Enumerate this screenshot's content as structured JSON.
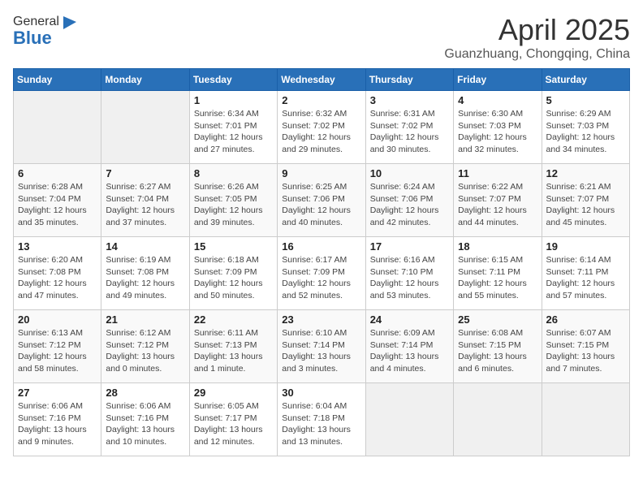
{
  "logo": {
    "general": "General",
    "blue": "Blue"
  },
  "title": "April 2025",
  "location": "Guanzhuang, Chongqing, China",
  "weekdays": [
    "Sunday",
    "Monday",
    "Tuesday",
    "Wednesday",
    "Thursday",
    "Friday",
    "Saturday"
  ],
  "weeks": [
    [
      {
        "day": null
      },
      {
        "day": null
      },
      {
        "day": "1",
        "sunrise": "Sunrise: 6:34 AM",
        "sunset": "Sunset: 7:01 PM",
        "daylight": "Daylight: 12 hours and 27 minutes."
      },
      {
        "day": "2",
        "sunrise": "Sunrise: 6:32 AM",
        "sunset": "Sunset: 7:02 PM",
        "daylight": "Daylight: 12 hours and 29 minutes."
      },
      {
        "day": "3",
        "sunrise": "Sunrise: 6:31 AM",
        "sunset": "Sunset: 7:02 PM",
        "daylight": "Daylight: 12 hours and 30 minutes."
      },
      {
        "day": "4",
        "sunrise": "Sunrise: 6:30 AM",
        "sunset": "Sunset: 7:03 PM",
        "daylight": "Daylight: 12 hours and 32 minutes."
      },
      {
        "day": "5",
        "sunrise": "Sunrise: 6:29 AM",
        "sunset": "Sunset: 7:03 PM",
        "daylight": "Daylight: 12 hours and 34 minutes."
      }
    ],
    [
      {
        "day": "6",
        "sunrise": "Sunrise: 6:28 AM",
        "sunset": "Sunset: 7:04 PM",
        "daylight": "Daylight: 12 hours and 35 minutes."
      },
      {
        "day": "7",
        "sunrise": "Sunrise: 6:27 AM",
        "sunset": "Sunset: 7:04 PM",
        "daylight": "Daylight: 12 hours and 37 minutes."
      },
      {
        "day": "8",
        "sunrise": "Sunrise: 6:26 AM",
        "sunset": "Sunset: 7:05 PM",
        "daylight": "Daylight: 12 hours and 39 minutes."
      },
      {
        "day": "9",
        "sunrise": "Sunrise: 6:25 AM",
        "sunset": "Sunset: 7:06 PM",
        "daylight": "Daylight: 12 hours and 40 minutes."
      },
      {
        "day": "10",
        "sunrise": "Sunrise: 6:24 AM",
        "sunset": "Sunset: 7:06 PM",
        "daylight": "Daylight: 12 hours and 42 minutes."
      },
      {
        "day": "11",
        "sunrise": "Sunrise: 6:22 AM",
        "sunset": "Sunset: 7:07 PM",
        "daylight": "Daylight: 12 hours and 44 minutes."
      },
      {
        "day": "12",
        "sunrise": "Sunrise: 6:21 AM",
        "sunset": "Sunset: 7:07 PM",
        "daylight": "Daylight: 12 hours and 45 minutes."
      }
    ],
    [
      {
        "day": "13",
        "sunrise": "Sunrise: 6:20 AM",
        "sunset": "Sunset: 7:08 PM",
        "daylight": "Daylight: 12 hours and 47 minutes."
      },
      {
        "day": "14",
        "sunrise": "Sunrise: 6:19 AM",
        "sunset": "Sunset: 7:08 PM",
        "daylight": "Daylight: 12 hours and 49 minutes."
      },
      {
        "day": "15",
        "sunrise": "Sunrise: 6:18 AM",
        "sunset": "Sunset: 7:09 PM",
        "daylight": "Daylight: 12 hours and 50 minutes."
      },
      {
        "day": "16",
        "sunrise": "Sunrise: 6:17 AM",
        "sunset": "Sunset: 7:09 PM",
        "daylight": "Daylight: 12 hours and 52 minutes."
      },
      {
        "day": "17",
        "sunrise": "Sunrise: 6:16 AM",
        "sunset": "Sunset: 7:10 PM",
        "daylight": "Daylight: 12 hours and 53 minutes."
      },
      {
        "day": "18",
        "sunrise": "Sunrise: 6:15 AM",
        "sunset": "Sunset: 7:11 PM",
        "daylight": "Daylight: 12 hours and 55 minutes."
      },
      {
        "day": "19",
        "sunrise": "Sunrise: 6:14 AM",
        "sunset": "Sunset: 7:11 PM",
        "daylight": "Daylight: 12 hours and 57 minutes."
      }
    ],
    [
      {
        "day": "20",
        "sunrise": "Sunrise: 6:13 AM",
        "sunset": "Sunset: 7:12 PM",
        "daylight": "Daylight: 12 hours and 58 minutes."
      },
      {
        "day": "21",
        "sunrise": "Sunrise: 6:12 AM",
        "sunset": "Sunset: 7:12 PM",
        "daylight": "Daylight: 13 hours and 0 minutes."
      },
      {
        "day": "22",
        "sunrise": "Sunrise: 6:11 AM",
        "sunset": "Sunset: 7:13 PM",
        "daylight": "Daylight: 13 hours and 1 minute."
      },
      {
        "day": "23",
        "sunrise": "Sunrise: 6:10 AM",
        "sunset": "Sunset: 7:14 PM",
        "daylight": "Daylight: 13 hours and 3 minutes."
      },
      {
        "day": "24",
        "sunrise": "Sunrise: 6:09 AM",
        "sunset": "Sunset: 7:14 PM",
        "daylight": "Daylight: 13 hours and 4 minutes."
      },
      {
        "day": "25",
        "sunrise": "Sunrise: 6:08 AM",
        "sunset": "Sunset: 7:15 PM",
        "daylight": "Daylight: 13 hours and 6 minutes."
      },
      {
        "day": "26",
        "sunrise": "Sunrise: 6:07 AM",
        "sunset": "Sunset: 7:15 PM",
        "daylight": "Daylight: 13 hours and 7 minutes."
      }
    ],
    [
      {
        "day": "27",
        "sunrise": "Sunrise: 6:06 AM",
        "sunset": "Sunset: 7:16 PM",
        "daylight": "Daylight: 13 hours and 9 minutes."
      },
      {
        "day": "28",
        "sunrise": "Sunrise: 6:06 AM",
        "sunset": "Sunset: 7:16 PM",
        "daylight": "Daylight: 13 hours and 10 minutes."
      },
      {
        "day": "29",
        "sunrise": "Sunrise: 6:05 AM",
        "sunset": "Sunset: 7:17 PM",
        "daylight": "Daylight: 13 hours and 12 minutes."
      },
      {
        "day": "30",
        "sunrise": "Sunrise: 6:04 AM",
        "sunset": "Sunset: 7:18 PM",
        "daylight": "Daylight: 13 hours and 13 minutes."
      },
      {
        "day": null
      },
      {
        "day": null
      },
      {
        "day": null
      }
    ]
  ]
}
